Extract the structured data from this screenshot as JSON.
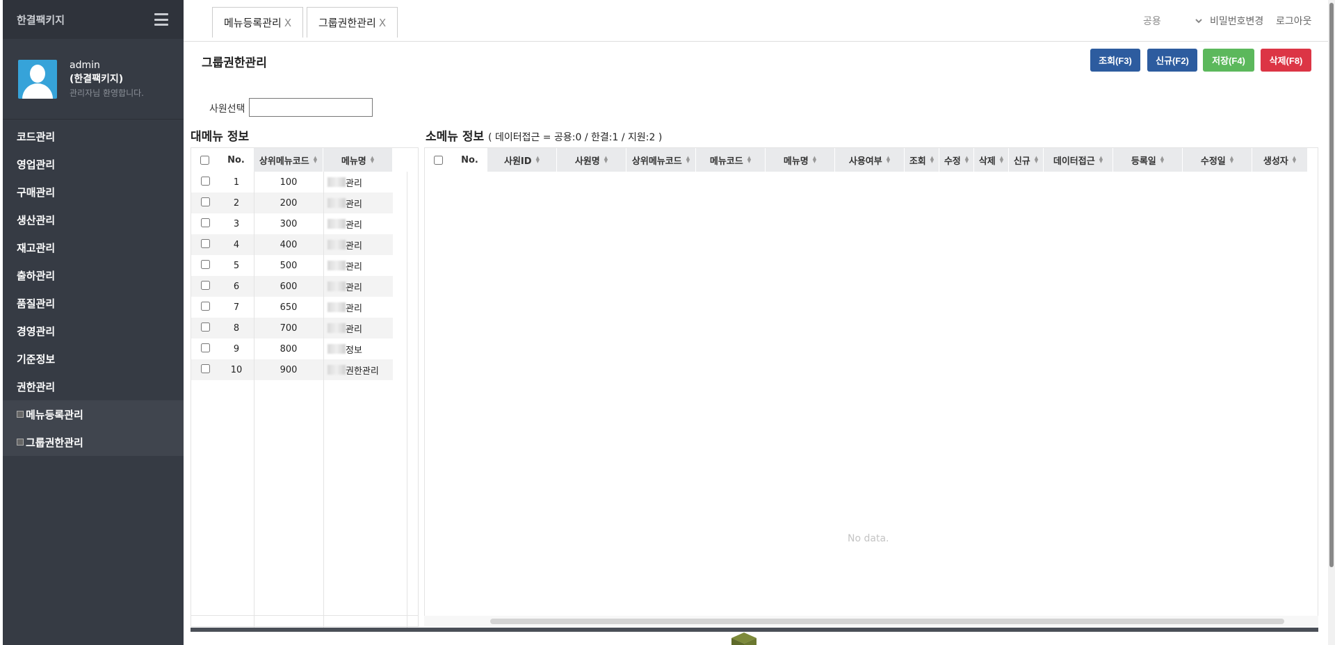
{
  "app": {
    "brand": "한결팩키지",
    "menu_icon": "hamburger-icon"
  },
  "user": {
    "name": "admin",
    "company": "(한결팩키지)",
    "welcome": "관리자님 환영합니다."
  },
  "nav": [
    {
      "label": "코드관리"
    },
    {
      "label": "영업관리"
    },
    {
      "label": "구매관리"
    },
    {
      "label": "생산관리"
    },
    {
      "label": "재고관리"
    },
    {
      "label": "출하관리"
    },
    {
      "label": "품질관리"
    },
    {
      "label": "경영관리"
    },
    {
      "label": "기준정보"
    },
    {
      "label": "권한관리"
    },
    {
      "label": "메뉴등록관리"
    },
    {
      "label": "그룹권한관리"
    }
  ],
  "tabs": [
    {
      "label": "메뉴등록관리",
      "close": "X"
    },
    {
      "label": "그룹권한관리",
      "close": "X"
    }
  ],
  "topbar": {
    "select_value": "공용",
    "change_password": "비밀번호변경",
    "logout": "로그아웃"
  },
  "page": {
    "title": "그룹권한관리",
    "buttons": {
      "search": "조회(F3)",
      "new": "신규(F2)",
      "save": "저장(F4)",
      "delete": "삭제(F8)"
    },
    "employee_label": "사원선택",
    "main_title": "대메뉴 정보",
    "sub_title": "소메뉴 정보",
    "sub_title_detail": "( 데이터접근 = 공용:0 / 한결:1 / 지원:2 )",
    "no_data": "No data."
  },
  "main_grid": {
    "headers": [
      "No.",
      "상위메뉴코드",
      "메뉴명"
    ],
    "rows": [
      {
        "no": "1",
        "code": "100",
        "name": "관리"
      },
      {
        "no": "2",
        "code": "200",
        "name": "관리"
      },
      {
        "no": "3",
        "code": "300",
        "name": "관리"
      },
      {
        "no": "4",
        "code": "400",
        "name": "관리"
      },
      {
        "no": "5",
        "code": "500",
        "name": "관리"
      },
      {
        "no": "6",
        "code": "600",
        "name": "관리"
      },
      {
        "no": "7",
        "code": "650",
        "name": "관리"
      },
      {
        "no": "8",
        "code": "700",
        "name": "관리"
      },
      {
        "no": "9",
        "code": "800",
        "name": "정보"
      },
      {
        "no": "10",
        "code": "900",
        "name": "권한관리"
      }
    ]
  },
  "sub_grid": {
    "headers": [
      "No.",
      "사원ID",
      "사원명",
      "상위메뉴코드",
      "메뉴코드",
      "메뉴명",
      "사용여부",
      "조회",
      "수정",
      "삭제",
      "신규",
      "데이터접근",
      "등록일",
      "수정일",
      "생성자"
    ]
  }
}
